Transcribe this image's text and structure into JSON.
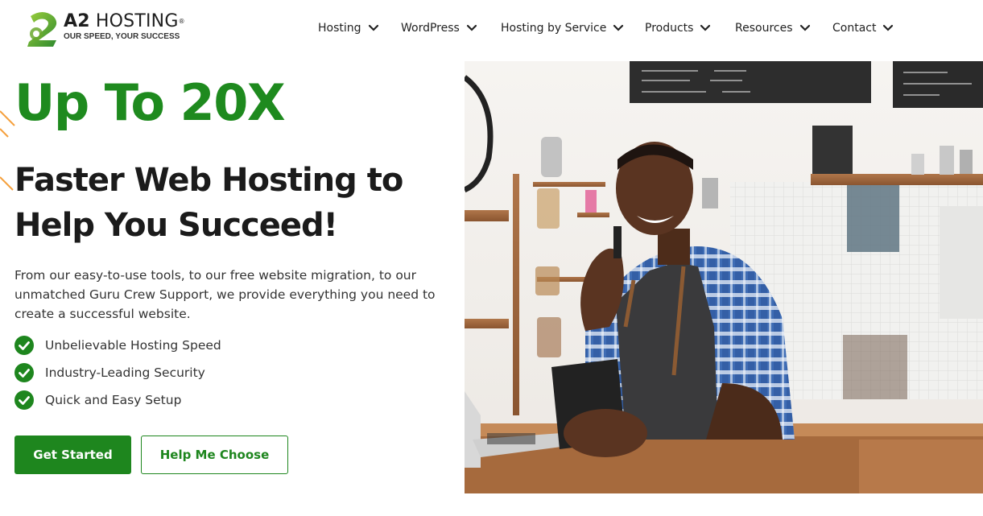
{
  "brand": {
    "name_bold": "A2",
    "name_rest": " HOSTING",
    "registered": "®",
    "tagline": "OUR SPEED, YOUR SUCCESS",
    "colors": {
      "green": "#1e861e",
      "orange": "#f5a03c"
    }
  },
  "nav": {
    "items": [
      {
        "label": "Hosting",
        "icon": "chevron-down-icon"
      },
      {
        "label": "WordPress",
        "icon": "chevron-down-icon"
      },
      {
        "label": "Hosting by Service",
        "icon": "chevron-down-icon"
      },
      {
        "label": "Products",
        "icon": "chevron-down-icon"
      },
      {
        "label": "Resources",
        "icon": "chevron-down-icon"
      },
      {
        "label": "Contact",
        "icon": "chevron-down-icon"
      }
    ]
  },
  "hero": {
    "headline": "Up To 20X",
    "subheadline": "Faster Web Hosting to Help You Succeed!",
    "description": "From our easy-to-use tools, to our free website migration, to our unmatched Guru Crew Support, we provide everything you need to create a successful website.",
    "features": [
      {
        "label": "Unbelievable Hosting Speed",
        "icon": "check-circle-icon"
      },
      {
        "label": "Industry-Leading Security",
        "icon": "check-circle-icon"
      },
      {
        "label": "Quick and Easy Setup",
        "icon": "check-circle-icon"
      }
    ],
    "primary_button": "Get Started",
    "secondary_button": "Help Me Choose",
    "photo": {
      "icon": "hero-photo-barista"
    }
  }
}
